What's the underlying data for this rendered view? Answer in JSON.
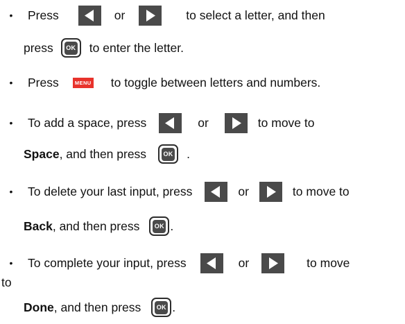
{
  "bullet": "•",
  "icons": {
    "left": "left-arrow-key-icon",
    "right": "right-arrow-key-icon",
    "ok": "ok-key-icon",
    "menu": "menu-key-icon"
  },
  "keys": {
    "ok_label": "OK",
    "menu_label": "MENU"
  },
  "colors": {
    "arrow_key": "#4a4a4a",
    "menu_key": "#e8322b",
    "text": "#111111"
  },
  "item1": {
    "press": "Press",
    "or": "or",
    "select": "to select a letter, and then",
    "press2": "press",
    "enter": "to enter the letter."
  },
  "item2": {
    "press": "Press",
    "toggle": "to toggle between letters and numbers."
  },
  "item3": {
    "add": "To add a space, press",
    "or": "or",
    "move": "to move to",
    "space": "Space",
    "then": ", and then press",
    "period": "."
  },
  "item4": {
    "delete": "To delete your last input, press",
    "or": "or",
    "move": "to move to",
    "back": "Back",
    "then": ", and then press",
    "period": "."
  },
  "item5": {
    "complete": "To complete your input, press",
    "or": "or",
    "move": "to move",
    "to": "to",
    "done": "Done",
    "then": ", and then press",
    "period": "."
  }
}
